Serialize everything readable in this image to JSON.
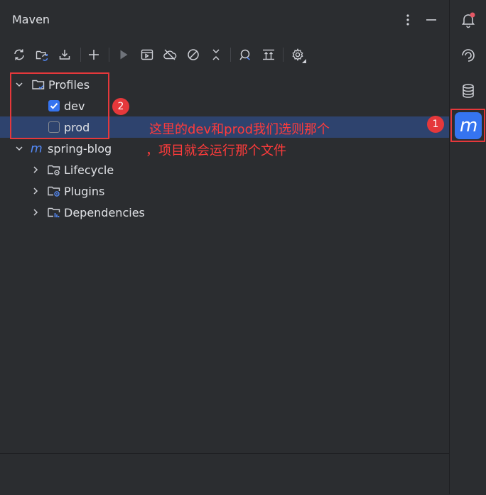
{
  "panel": {
    "title": "Maven"
  },
  "toolbar": {
    "buttons": [
      "reload-all-icon",
      "reload-project-icon",
      "download-icon",
      "add-icon",
      "run-icon",
      "execute-goal-icon",
      "offline-icon",
      "skip-tests-icon",
      "collapse-icon",
      "analyze-icon",
      "expand-all-icon",
      "settings-icon"
    ]
  },
  "tree": {
    "profiles_label": "Profiles",
    "profiles": [
      {
        "label": "dev",
        "checked": true
      },
      {
        "label": "prod",
        "checked": false
      }
    ],
    "project_label": "spring-blog",
    "children": [
      {
        "label": "Lifecycle"
      },
      {
        "label": "Plugins"
      },
      {
        "label": "Dependencies"
      }
    ]
  },
  "annotations": {
    "badge1": "1",
    "badge2": "2",
    "line1": "这里的dev和prod我们选则那个",
    "line2": "，项目就会运行那个文件"
  },
  "colors": {
    "accent": "#3574f0",
    "annotation": "#e5383b",
    "selection": "#2e436e"
  }
}
